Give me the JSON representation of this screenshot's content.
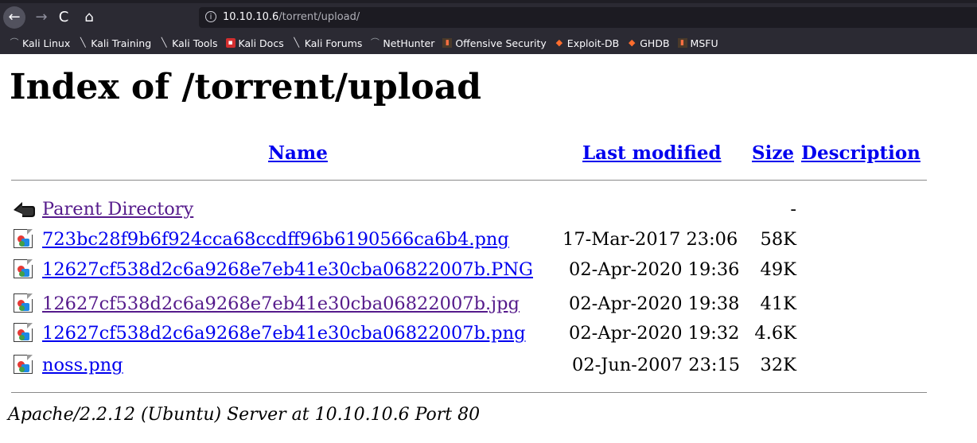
{
  "browser": {
    "url_host": "10.10.10.6",
    "url_path": "/torrent/upload/",
    "nav": {
      "back": "←",
      "forward": "→",
      "reload": "C",
      "home": "⌂",
      "info": "i"
    },
    "bookmarks": [
      {
        "label": "Kali Linux",
        "icon": "kali-icon"
      },
      {
        "label": "Kali Training",
        "icon": "dragon-icon"
      },
      {
        "label": "Kali Tools",
        "icon": "dragon-icon"
      },
      {
        "label": "Kali Docs",
        "icon": "docs-icon"
      },
      {
        "label": "Kali Forums",
        "icon": "dragon-icon"
      },
      {
        "label": "NetHunter",
        "icon": "kali-icon"
      },
      {
        "label": "Offensive Security",
        "icon": "offsec-icon"
      },
      {
        "label": "Exploit-DB",
        "icon": "exploitdb-icon"
      },
      {
        "label": "GHDB",
        "icon": "exploitdb-icon"
      },
      {
        "label": "MSFU",
        "icon": "offsec-icon"
      }
    ]
  },
  "page": {
    "title": "Index of /torrent/upload",
    "columns": {
      "name": "Name",
      "modified": "Last modified",
      "size": "Size",
      "description": "Description"
    },
    "parent": {
      "name": "Parent Directory",
      "size": "-"
    },
    "files": [
      {
        "name": "723bc28f9b6f924cca68ccdff96b6190566ca6b4.png",
        "modified": "17-Mar-2017 23:06",
        "size": "58K"
      },
      {
        "name": "12627cf538d2c6a9268e7eb41e30cba06822007b.PNG",
        "modified": "02-Apr-2020 19:36",
        "size": "49K"
      },
      {
        "name": "12627cf538d2c6a9268e7eb41e30cba06822007b.jpg",
        "modified": "02-Apr-2020 19:38",
        "size": "41K"
      },
      {
        "name": "12627cf538d2c6a9268e7eb41e30cba06822007b.png",
        "modified": "02-Apr-2020 19:32",
        "size": "4.6K"
      },
      {
        "name": "noss.png",
        "modified": "02-Jun-2007 23:15",
        "size": "32K"
      }
    ],
    "footer": "Apache/2.2.12 (Ubuntu) Server at 10.10.10.6 Port 80"
  },
  "colors": {
    "link": "#0000ee",
    "visited": "#551a8b",
    "chrome_bg": "#2b2a33",
    "urlbar_bg": "#1c1b22"
  }
}
